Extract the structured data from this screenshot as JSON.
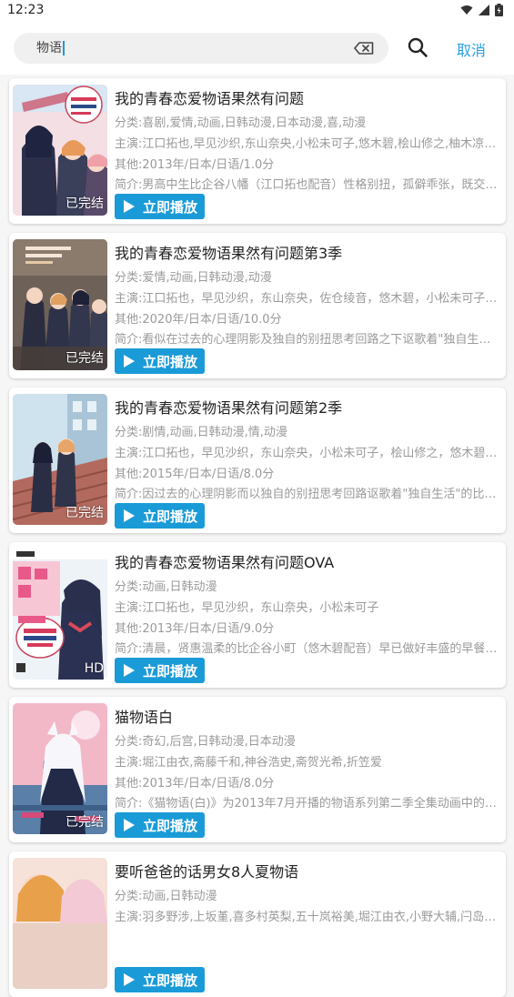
{
  "status": {
    "time": "12:23"
  },
  "search": {
    "query": "物语",
    "cancel_label": "取消"
  },
  "colors": {
    "accent": "#1a9bd8"
  },
  "results": [
    {
      "title": "我的青春恋爱物语果然有问题",
      "category": "分类:喜剧,爱情,动画,日韩动漫,日本动漫,喜,动漫",
      "cast": "主演:江口拓也,早见沙织,东山奈央,小松未可子,悠木碧,桧山修之,柚木凉香,中...",
      "other": "其他:2013年/日本/日语/1.0分",
      "intro": "简介:男高中生比企谷八幡（江口拓也配音）性格别扭，孤僻乖张，既交不上...",
      "badge": "已完结",
      "play_label": "立即播放"
    },
    {
      "title": "我的青春恋爱物语果然有问题第3季",
      "category": "分类:爱情,动画,日韩动漫,动漫",
      "cast": "主演:江口拓也，早见沙织，东山奈央，佐仓绫音，悠木碧，小松未可子，近藤隆...",
      "other": "其他:2020年/日本/日语/10.0分",
      "intro": "简介:看似在过去的心理阴影及独自的别扭思考回路之下讴歌着\"独自生活\"的...",
      "badge": "已完结",
      "play_label": "立即播放"
    },
    {
      "title": "我的青春恋爱物语果然有问题第2季",
      "category": "分类:剧情,动画,日韩动漫,情,动漫",
      "cast": "主演:江口拓也，早见沙织，东山奈央，小松未可子，桧山修之，悠木碧，柚木凉...",
      "other": "其他:2015年/日本/日语/8.0分",
      "intro": "简介:因过去的心理阴影而以独自的别扭思考回路讴歌着\"独自生活\"的比企谷...",
      "badge": "已完结",
      "play_label": "立即播放"
    },
    {
      "title": "我的青春恋爱物语果然有问题OVA",
      "category": "分类:动画,日韩动漫",
      "cast": "主演:江口拓也，早见沙织，东山奈央，小松未可子",
      "other": "其他:2013年/日本/日语/9.0分",
      "intro": "简介:清晨，贤惠温柔的比企谷小町（悠木碧配音）早已做好丰盛的早餐，而...",
      "badge": "HD",
      "play_label": "立即播放"
    },
    {
      "title": "猫物语白",
      "category": "分类:奇幻,后宫,日韩动漫,日本动漫",
      "cast": "主演:堀江由衣,斋藤千和,神谷浩史,斋贺光希,折笠爱",
      "other": "其他:2013年/日本/日语/8.0分",
      "intro": "简介:《猫物语(白)》为2013年7月开播的物语系列第二季全集动画中的猫物...",
      "badge": "已完结",
      "play_label": "立即播放"
    },
    {
      "title": "要听爸爸的话男女8人夏物语",
      "category": "分类:动画,日韩动漫",
      "cast": "主演:羽多野涉,上坂堇,喜多村英梨,五十岚裕美,堀江由衣,小野大辅,闩岛凉司",
      "other": "",
      "intro": "",
      "badge": "",
      "play_label": "立即播放"
    }
  ]
}
